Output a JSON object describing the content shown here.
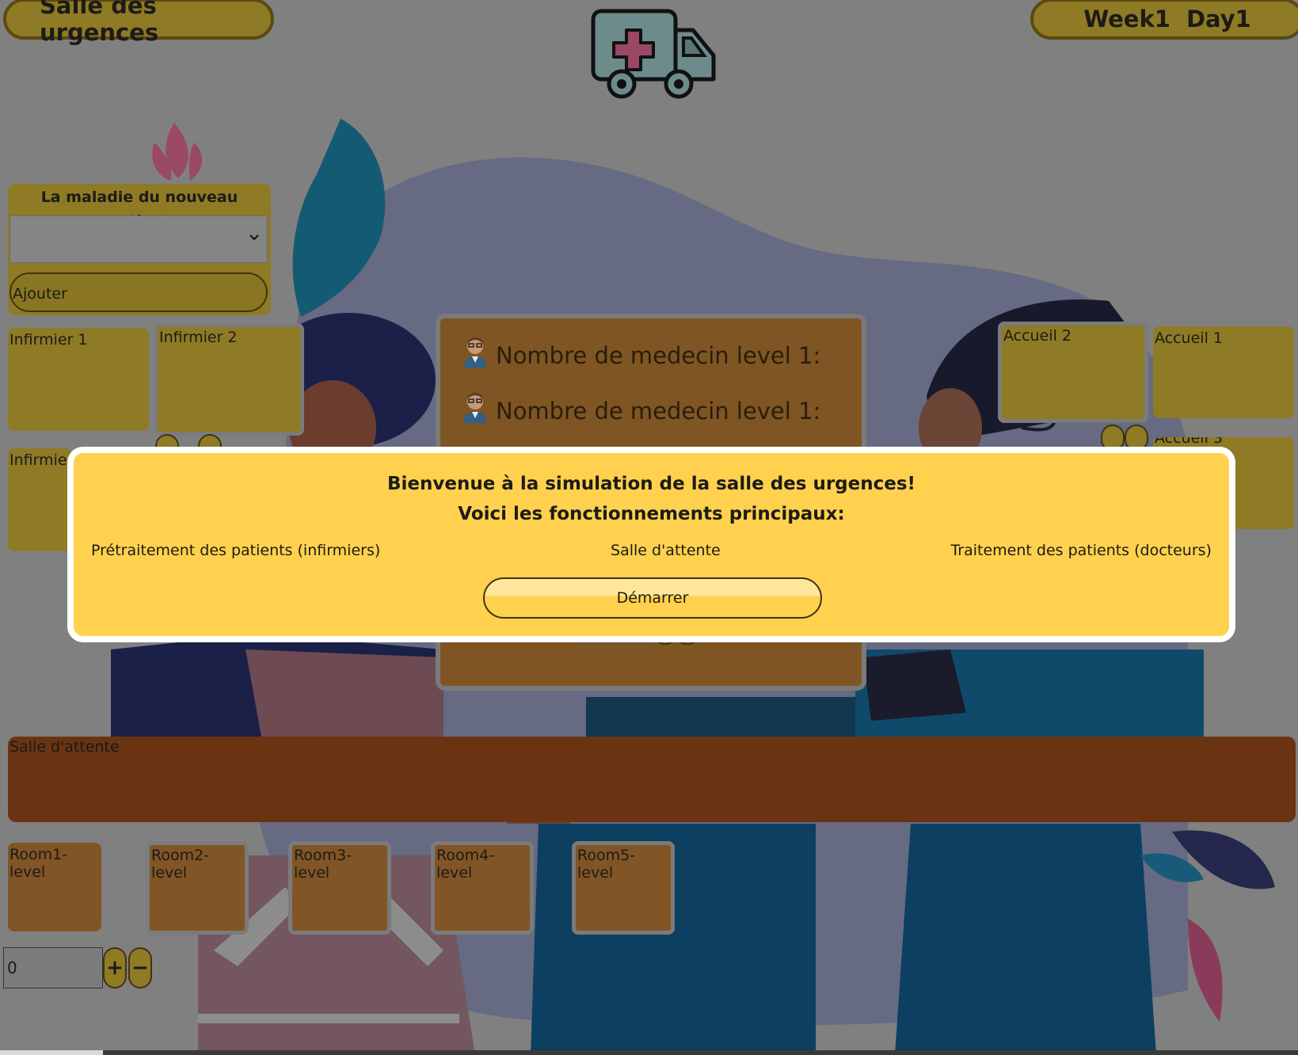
{
  "app": {
    "title": "Salle des urgences",
    "week": "Week1",
    "day": "Day1"
  },
  "new_patient": {
    "title": "La maladie du nouveau patient",
    "select_value": "",
    "add_label": "Ajouter"
  },
  "nurses": [
    "Infirmier 1",
    "Infirmier 2",
    "Infirmier"
  ],
  "receptions": [
    "Accueil 2",
    "Accueil 1",
    "Accueil 3"
  ],
  "doctors": {
    "lines": [
      "Nombre de medecin level 1:",
      "Nombre de medecin level 1:"
    ]
  },
  "waiting_room": {
    "label": "Salle d'attente"
  },
  "rooms": [
    "Room1-level",
    "Room2-level",
    "Room3-level",
    "Room4-level",
    "Room5-level"
  ],
  "counter": {
    "value": "0",
    "plus": "+",
    "minus": "−"
  },
  "modal": {
    "heading": "Bienvenue à la simulation de la salle des urgences!",
    "subheading": "Voici les fonctionnements principaux:",
    "columns": [
      "Prétraitement des patients (infirmiers)",
      "Salle d'attente",
      "Traitement des patients (docteurs)"
    ],
    "start_label": "Démarrer"
  },
  "colors": {
    "overlay": "#808080",
    "modal_bg": "#ffd14e",
    "tile_gold": "#8f7a26",
    "waiting_brown": "#6a3413",
    "room_brown": "#815526"
  }
}
